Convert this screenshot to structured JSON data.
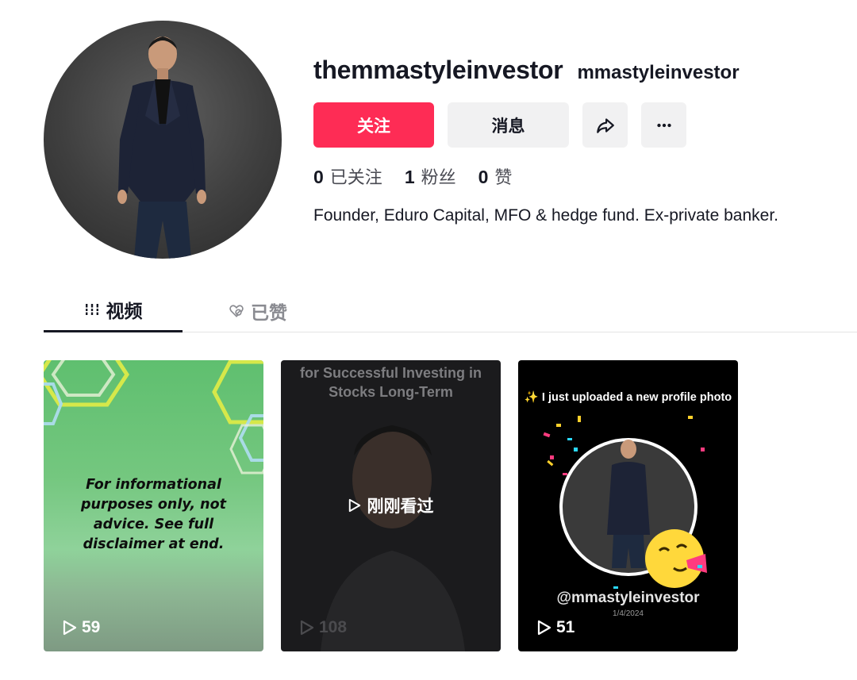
{
  "profile": {
    "username": "themmastyleinvestor",
    "nickname": "mmastyleinvestor",
    "bio": "Founder, Eduro Capital, MFO & hedge fund. Ex-private banker."
  },
  "actions": {
    "follow_label": "关注",
    "message_label": "消息",
    "share_icon": "share-icon",
    "more_icon": "more-icon"
  },
  "stats": [
    {
      "value": "0",
      "label": "已关注"
    },
    {
      "value": "1",
      "label": "粉丝"
    },
    {
      "value": "0",
      "label": "赞"
    }
  ],
  "tabs": [
    {
      "label": "视频",
      "icon": "grid-icon",
      "active": true
    },
    {
      "label": "已赞",
      "icon": "heart-icon",
      "active": false
    }
  ],
  "videos": [
    {
      "overlay_text": "For informational purposes only, not advice. See full disclaimer at end.",
      "views": "59"
    },
    {
      "title_text": "for Successful Investing in Stocks Long-Term",
      "status": "刚刚看过",
      "views": "108"
    },
    {
      "title_text": "✨ I just uploaded a new profile photo",
      "handle": "@mmastyleinvestor",
      "date": "1/4/2024",
      "views": "51"
    }
  ],
  "colors": {
    "accent": "#fe2c55",
    "button_gray": "#f1f1f2",
    "text": "#161823"
  }
}
